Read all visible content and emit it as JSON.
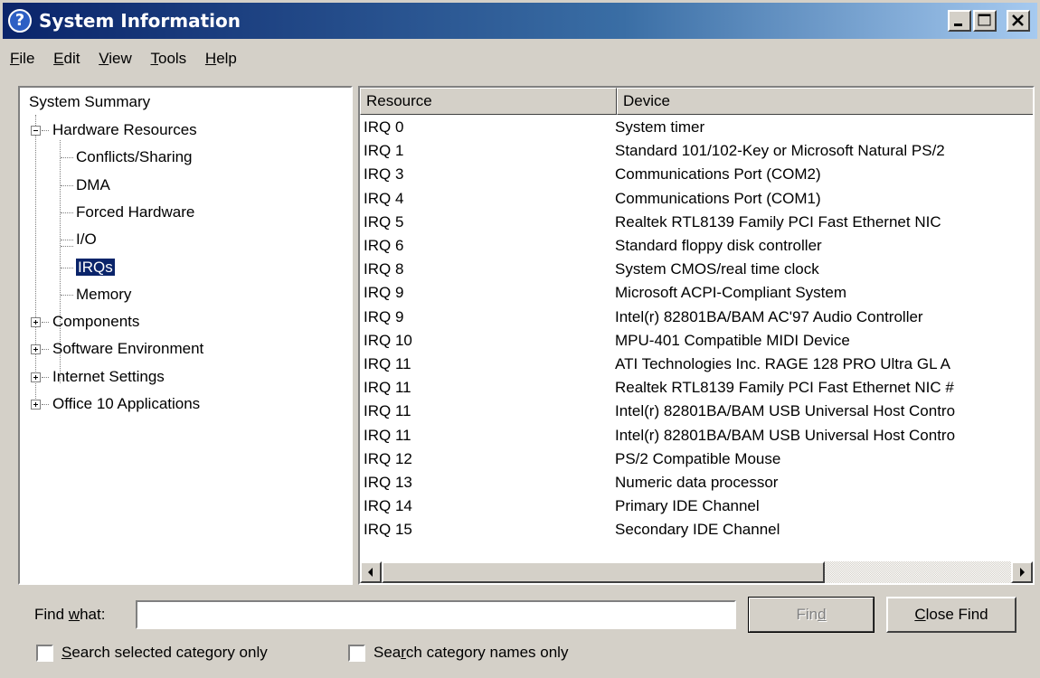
{
  "window": {
    "title": "System Information"
  },
  "menu": [
    {
      "pre": "",
      "key": "F",
      "post": "ile"
    },
    {
      "pre": "",
      "key": "E",
      "post": "dit"
    },
    {
      "pre": "",
      "key": "V",
      "post": "iew"
    },
    {
      "pre": "",
      "key": "T",
      "post": "ools"
    },
    {
      "pre": "",
      "key": "H",
      "post": "elp"
    }
  ],
  "tree": {
    "root": "System Summary",
    "hardware": "Hardware Resources",
    "hw_children": [
      "Conflicts/Sharing",
      "DMA",
      "Forced Hardware",
      "I/O",
      "IRQs",
      "Memory"
    ],
    "selected": "IRQs",
    "others": [
      "Components",
      "Software Environment",
      "Internet Settings",
      "Office 10 Applications"
    ]
  },
  "list": {
    "headers": {
      "resource": "Resource",
      "device": "Device"
    },
    "rows": [
      {
        "resource": "IRQ 0",
        "device": "System timer"
      },
      {
        "resource": "IRQ 1",
        "device": "Standard 101/102-Key or Microsoft Natural PS/2"
      },
      {
        "resource": "IRQ 3",
        "device": "Communications Port (COM2)"
      },
      {
        "resource": "IRQ 4",
        "device": "Communications Port (COM1)"
      },
      {
        "resource": "IRQ 5",
        "device": "Realtek RTL8139 Family PCI Fast Ethernet NIC"
      },
      {
        "resource": "IRQ 6",
        "device": "Standard floppy disk controller"
      },
      {
        "resource": "IRQ 8",
        "device": "System CMOS/real time clock"
      },
      {
        "resource": "IRQ 9",
        "device": "Microsoft ACPI-Compliant System"
      },
      {
        "resource": "IRQ 9",
        "device": "Intel(r) 82801BA/BAM AC'97 Audio Controller"
      },
      {
        "resource": "IRQ 10",
        "device": "MPU-401 Compatible MIDI Device"
      },
      {
        "resource": "IRQ 11",
        "device": "ATI Technologies Inc. RAGE 128 PRO Ultra GL A"
      },
      {
        "resource": "IRQ 11",
        "device": "Realtek RTL8139 Family PCI Fast Ethernet NIC #"
      },
      {
        "resource": "IRQ 11",
        "device": "Intel(r) 82801BA/BAM USB Universal Host Contro"
      },
      {
        "resource": "IRQ 11",
        "device": "Intel(r) 82801BA/BAM USB Universal Host Contro"
      },
      {
        "resource": "IRQ 12",
        "device": "PS/2 Compatible Mouse"
      },
      {
        "resource": "IRQ 13",
        "device": "Numeric data processor"
      },
      {
        "resource": "IRQ 14",
        "device": "Primary IDE Channel"
      },
      {
        "resource": "IRQ 15",
        "device": "Secondary IDE Channel"
      }
    ]
  },
  "find": {
    "label_pre": "Find ",
    "label_key": "w",
    "label_post": "hat:",
    "value": "",
    "find_pre": "Fin",
    "find_key": "d",
    "find_post": "",
    "close_pre": "",
    "close_key": "C",
    "close_post": "lose Find",
    "chk1_pre": "",
    "chk1_key": "S",
    "chk1_post": "earch selected category only",
    "chk2_pre": "Sea",
    "chk2_key": "r",
    "chk2_post": "ch category names only"
  },
  "icons": {
    "title": "help-icon",
    "minimize": "minimize-icon",
    "maximize": "maximize-icon",
    "close": "close-icon"
  },
  "colors": {
    "titlebar_start": "#0a246a",
    "titlebar_end": "#a6caf0",
    "selection": "#0a246a",
    "face": "#d4d0c8"
  }
}
